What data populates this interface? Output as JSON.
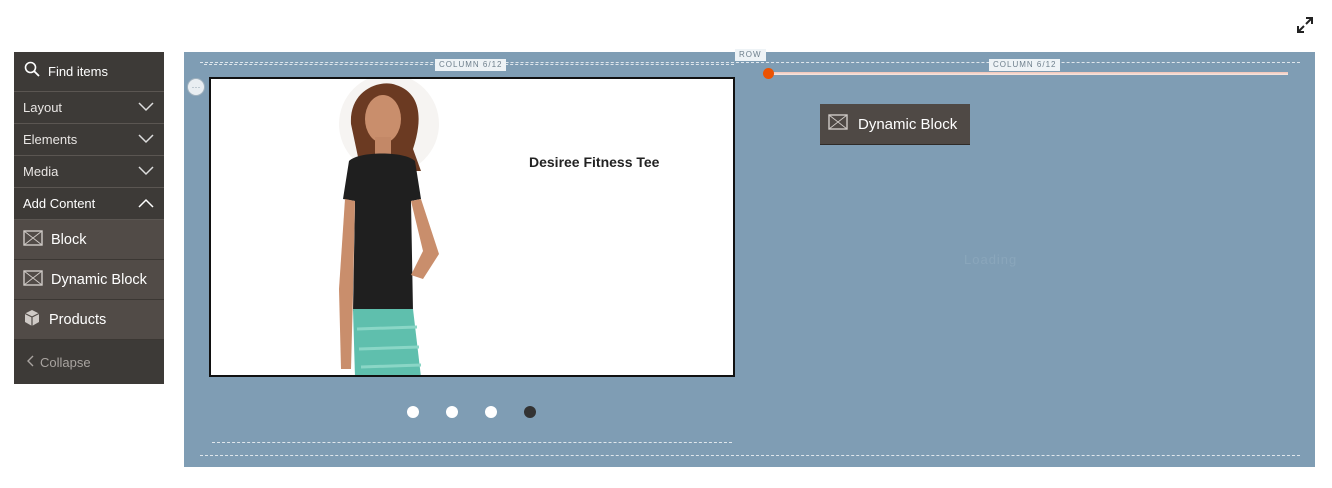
{
  "toolbar": {
    "fullscreen_icon": "expand-arrows-icon"
  },
  "panel": {
    "search_label": "Find items",
    "sections": [
      {
        "label": "Layout",
        "state": "collapsed"
      },
      {
        "label": "Elements",
        "state": "collapsed"
      },
      {
        "label": "Media",
        "state": "collapsed"
      },
      {
        "label": "Add Content",
        "state": "expanded"
      }
    ],
    "items": [
      {
        "label": "Block",
        "icon": "block-icon"
      },
      {
        "label": "Dynamic Block",
        "icon": "dynamic-block-icon"
      },
      {
        "label": "Products",
        "icon": "products-icon"
      }
    ],
    "collapse_label": "Collapse"
  },
  "stage": {
    "row_tag": "ROW",
    "left_column_tag": "COLUMN 6/12",
    "right_column_tag": "COLUMN 6/12",
    "slide": {
      "product_title": "Desiree Fitness Tee",
      "image": "woman-in-black-tee-photo"
    },
    "slider_dots": 4,
    "active_dot": 4,
    "dynamic_block_label": "Dynamic Block",
    "ghost_text": "Loading"
  },
  "colors": {
    "accent": "#eb5202",
    "stage_bg": "#7f9db4",
    "panel_bg": "#3d3a37",
    "item_bg": "#514b47"
  }
}
